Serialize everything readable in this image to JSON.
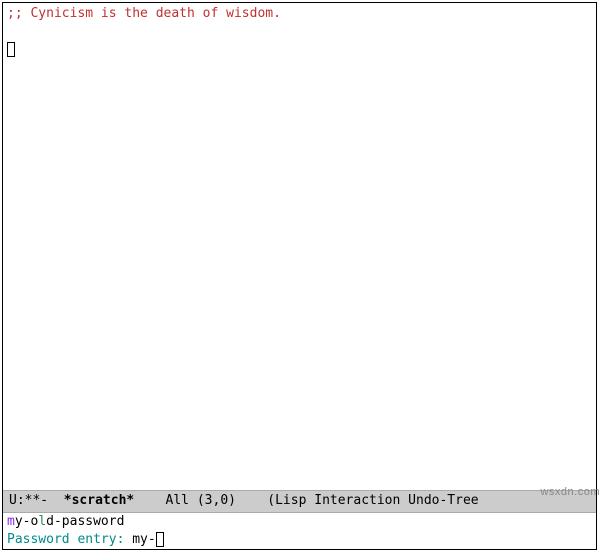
{
  "editor": {
    "comment": ";; Cynicism is the death of wisdom."
  },
  "modeline": {
    "status": "U:**-",
    "buffer": "*scratch*",
    "position": "All (3,0)",
    "modes": "(Lisp Interaction Undo-Tree"
  },
  "minibuffer": {
    "completion_p1": "m",
    "completion_p2": "y-o",
    "completion_p3": "l",
    "completion_p4": "d-password",
    "prompt": "Password entry: ",
    "input": "my-"
  },
  "watermark": "wsxdn.com"
}
